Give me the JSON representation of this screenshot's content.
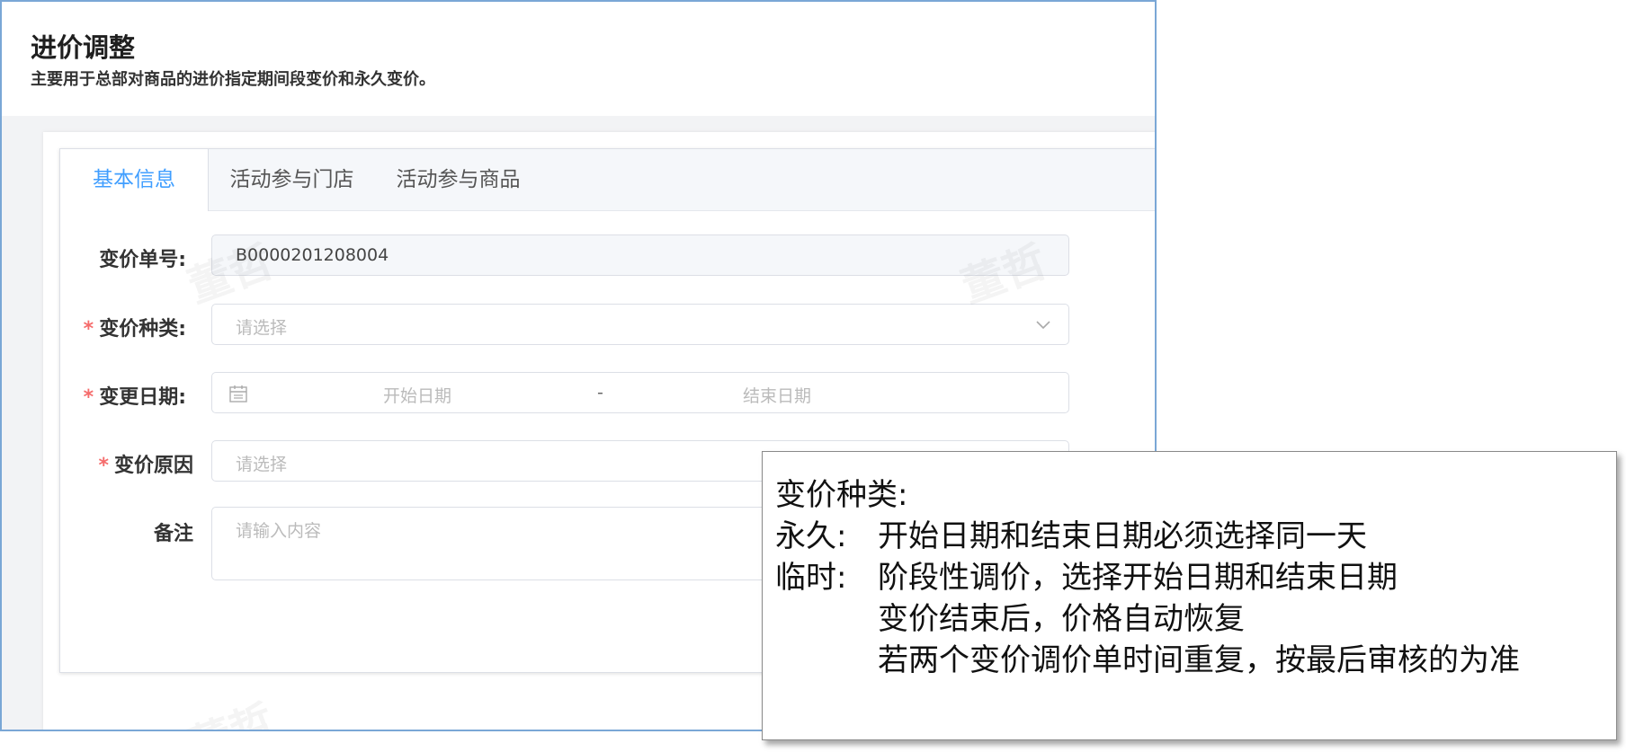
{
  "header": {
    "title": "进价调整",
    "subtitle": "主要用于总部对商品的进价指定期间段变价和永久变价。"
  },
  "tabs": [
    {
      "label": "基本信息",
      "active": true
    },
    {
      "label": "活动参与门店",
      "active": false
    },
    {
      "label": "活动参与商品",
      "active": false
    }
  ],
  "form": {
    "order_no": {
      "label": "变价单号:",
      "value": "B0000201208004"
    },
    "price_type": {
      "label": "变价种类:",
      "placeholder": "请选择"
    },
    "change_date": {
      "label": "变更日期:",
      "start_placeholder": "开始日期",
      "separator": "-",
      "end_placeholder": "结束日期"
    },
    "reason": {
      "label": "变价原因",
      "placeholder": "请选择"
    },
    "remark": {
      "label": "备注",
      "placeholder": "请输入内容"
    }
  },
  "required_mark": "*",
  "watermark": "董哲",
  "note": {
    "title": "变价种类:",
    "lines": [
      {
        "prefix": "永久:",
        "text": "开始日期和结束日期必须选择同一天"
      },
      {
        "prefix": "临时:",
        "text": "阶段性调价，选择开始日期和结束日期"
      },
      {
        "prefix": "",
        "text": "变价结束后，价格自动恢复"
      },
      {
        "prefix": "",
        "text": "若两个变价调价单时间重复，按最后审核的为准"
      }
    ]
  },
  "colors": {
    "accent": "#409eff",
    "required": "#f56c6c",
    "frame_border": "#7aa7d6"
  },
  "icons": {
    "select_arrow": "chevron-down-icon",
    "date": "calendar-icon"
  }
}
